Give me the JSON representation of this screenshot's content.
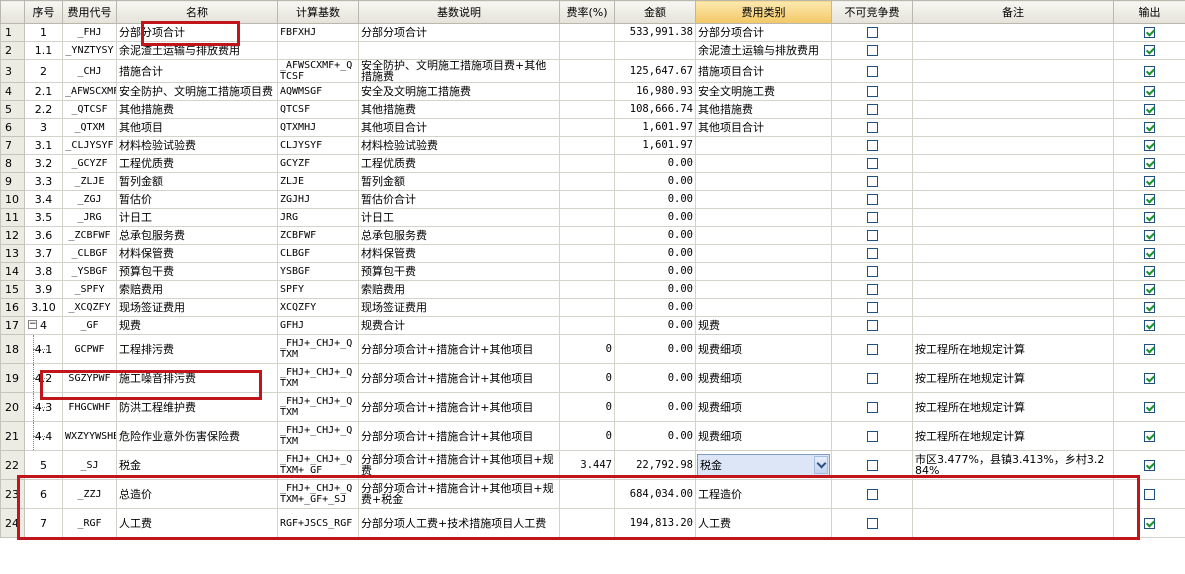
{
  "headers": [
    "序号",
    "费用代号",
    "名称",
    "计算基数",
    "基数说明",
    "费率(%)",
    "金额",
    "费用类别",
    "不可竞争费",
    "备注",
    "输出"
  ],
  "rows": [
    {
      "idx": "1",
      "seq": "1",
      "code": "_FHJ",
      "name": "分部分项合计",
      "base": "FBFXHJ",
      "desc": "分部分项合计",
      "rate": "",
      "amount": "533,991.38",
      "category": "分部分项合计",
      "noncomp": false,
      "remark": "",
      "output": true
    },
    {
      "idx": "2",
      "seq": "1.1",
      "code": "_YNZTYSY",
      "name": "余泥渣土运输与排放费用",
      "base": "",
      "desc": "",
      "rate": "",
      "amount": "",
      "category": "余泥渣土运输与排放费用",
      "noncomp": false,
      "remark": "",
      "output": true
    },
    {
      "idx": "3",
      "seq": "2",
      "code": "_CHJ",
      "name": "措施合计",
      "base": "_AFWSCXMF+_QTCSF",
      "desc": "安全防护、文明施工措施项目费+其他措施费",
      "rate": "",
      "amount": "125,647.67",
      "category": "措施项目合计",
      "noncomp": false,
      "remark": "",
      "output": true
    },
    {
      "idx": "4",
      "seq": "2.1",
      "code": "_AFWSCXMF",
      "name": "安全防护、文明施工措施项目费",
      "base": "AQWMSGF",
      "desc": "安全及文明施工措施费",
      "rate": "",
      "amount": "16,980.93",
      "category": "安全文明施工费",
      "noncomp": false,
      "remark": "",
      "output": true
    },
    {
      "idx": "5",
      "seq": "2.2",
      "code": "_QTCSF",
      "name": "其他措施费",
      "base": "QTCSF",
      "desc": "其他措施费",
      "rate": "",
      "amount": "108,666.74",
      "category": "其他措施费",
      "noncomp": false,
      "remark": "",
      "output": true
    },
    {
      "idx": "6",
      "seq": "3",
      "code": "_QTXM",
      "name": "其他项目",
      "base": "QTXMHJ",
      "desc": "其他项目合计",
      "rate": "",
      "amount": "1,601.97",
      "category": "其他项目合计",
      "noncomp": false,
      "remark": "",
      "output": true
    },
    {
      "idx": "7",
      "seq": "3.1",
      "code": "_CLJYSYF",
      "name": "材料检验试验费",
      "base": "CLJYSYF",
      "desc": "材料检验试验费",
      "rate": "",
      "amount": "1,601.97",
      "category": "",
      "noncomp": false,
      "remark": "",
      "output": true
    },
    {
      "idx": "8",
      "seq": "3.2",
      "code": "_GCYZF",
      "name": "工程优质费",
      "base": "GCYZF",
      "desc": "工程优质费",
      "rate": "",
      "amount": "0.00",
      "category": "",
      "noncomp": false,
      "remark": "",
      "output": true
    },
    {
      "idx": "9",
      "seq": "3.3",
      "code": "_ZLJE",
      "name": "暂列金额",
      "base": "ZLJE",
      "desc": "暂列金额",
      "rate": "",
      "amount": "0.00",
      "category": "",
      "noncomp": false,
      "remark": "",
      "output": true
    },
    {
      "idx": "10",
      "seq": "3.4",
      "code": "_ZGJ",
      "name": "暂估价",
      "base": "ZGJHJ",
      "desc": "暂估价合计",
      "rate": "",
      "amount": "0.00",
      "category": "",
      "noncomp": false,
      "remark": "",
      "output": true
    },
    {
      "idx": "11",
      "seq": "3.5",
      "code": "_JRG",
      "name": "计日工",
      "base": "JRG",
      "desc": "计日工",
      "rate": "",
      "amount": "0.00",
      "category": "",
      "noncomp": false,
      "remark": "",
      "output": true
    },
    {
      "idx": "12",
      "seq": "3.6",
      "code": "_ZCBFWF",
      "name": "总承包服务费",
      "base": "ZCBFWF",
      "desc": "总承包服务费",
      "rate": "",
      "amount": "0.00",
      "category": "",
      "noncomp": false,
      "remark": "",
      "output": true
    },
    {
      "idx": "13",
      "seq": "3.7",
      "code": "_CLBGF",
      "name": "材料保管费",
      "base": "CLBGF",
      "desc": "材料保管费",
      "rate": "",
      "amount": "0.00",
      "category": "",
      "noncomp": false,
      "remark": "",
      "output": true
    },
    {
      "idx": "14",
      "seq": "3.8",
      "code": "_YSBGF",
      "name": "预算包干费",
      "base": "YSBGF",
      "desc": "预算包干费",
      "rate": "",
      "amount": "0.00",
      "category": "",
      "noncomp": false,
      "remark": "",
      "output": true
    },
    {
      "idx": "15",
      "seq": "3.9",
      "code": "_SPFY",
      "name": "索赔费用",
      "base": "SPFY",
      "desc": "索赔费用",
      "rate": "",
      "amount": "0.00",
      "category": "",
      "noncomp": false,
      "remark": "",
      "output": true
    },
    {
      "idx": "16",
      "seq": "3.10",
      "code": "_XCQZFY",
      "name": "现场签证费用",
      "base": "XCQZFY",
      "desc": "现场签证费用",
      "rate": "",
      "amount": "0.00",
      "category": "",
      "noncomp": false,
      "remark": "",
      "output": true
    },
    {
      "idx": "17",
      "seq": "4",
      "code": "_GF",
      "name": "规费",
      "base": "GFHJ",
      "desc": "规费合计",
      "rate": "",
      "amount": "0.00",
      "category": "规费",
      "noncomp": false,
      "remark": "",
      "output": true,
      "toggle": "−"
    },
    {
      "idx": "18",
      "seq": "4.1",
      "code": "GCPWF",
      "name": "工程排污费",
      "base": "_FHJ+_CHJ+_QTXM",
      "desc": "分部分项合计+措施合计+其他项目",
      "rate": "0",
      "amount": "0.00",
      "category": "规费细项",
      "noncomp": false,
      "remark": "按工程所在地规定计算",
      "output": true,
      "tall": true,
      "child": true
    },
    {
      "idx": "19",
      "seq": "4.2",
      "code": "SGZYPWF",
      "name": "施工噪音排污费",
      "base": "_FHJ+_CHJ+_QTXM",
      "desc": "分部分项合计+措施合计+其他项目",
      "rate": "0",
      "amount": "0.00",
      "category": "规费细项",
      "noncomp": false,
      "remark": "按工程所在地规定计算",
      "output": true,
      "tall": true,
      "child": true
    },
    {
      "idx": "20",
      "seq": "4.3",
      "code": "FHGCWHF",
      "name": "防洪工程维护费",
      "base": "_FHJ+_CHJ+_QTXM",
      "desc": "分部分项合计+措施合计+其他项目",
      "rate": "0",
      "amount": "0.00",
      "category": "规费细项",
      "noncomp": false,
      "remark": "按工程所在地规定计算",
      "output": true,
      "tall": true,
      "child": true
    },
    {
      "idx": "21",
      "seq": "4.4",
      "code": "WXZYYWSHBXF",
      "name": "危险作业意外伤害保险费",
      "base": "_FHJ+_CHJ+_QTXM",
      "desc": "分部分项合计+措施合计+其他项目",
      "rate": "0",
      "amount": "0.00",
      "category": "规费细项",
      "noncomp": false,
      "remark": "按工程所在地规定计算",
      "output": true,
      "tall": true,
      "child": true
    },
    {
      "idx": "22",
      "seq": "5",
      "code": "_SJ",
      "name": "税金",
      "base": "_FHJ+_CHJ+_QTXM+_GF",
      "desc": "分部分项合计+措施合计+其他项目+规费",
      "rate": "3.447",
      "amount": "22,792.98",
      "category": "税金",
      "noncomp": false,
      "remark": "市区3.477%，县镇3.413%，乡村3.284%",
      "output": true,
      "tall": true,
      "dropdown": true
    },
    {
      "idx": "23",
      "seq": "6",
      "code": "_ZZJ",
      "name": "总造价",
      "base": "_FHJ+_CHJ+_QTXM+_GF+_SJ",
      "desc": "分部分项合计+措施合计+其他项目+规费+税金",
      "rate": "",
      "amount": "684,034.00",
      "category": "工程造价",
      "noncomp": false,
      "remark": "",
      "output": false,
      "tall": true
    },
    {
      "idx": "24",
      "seq": "7",
      "code": "_RGF",
      "name": "人工费",
      "base": "RGF+JSCS_RGF",
      "desc": "分部分项人工费+技术措施项目人工费",
      "rate": "",
      "amount": "194,813.20",
      "category": "人工费",
      "noncomp": false,
      "remark": "",
      "output": true,
      "tall": true
    }
  ]
}
